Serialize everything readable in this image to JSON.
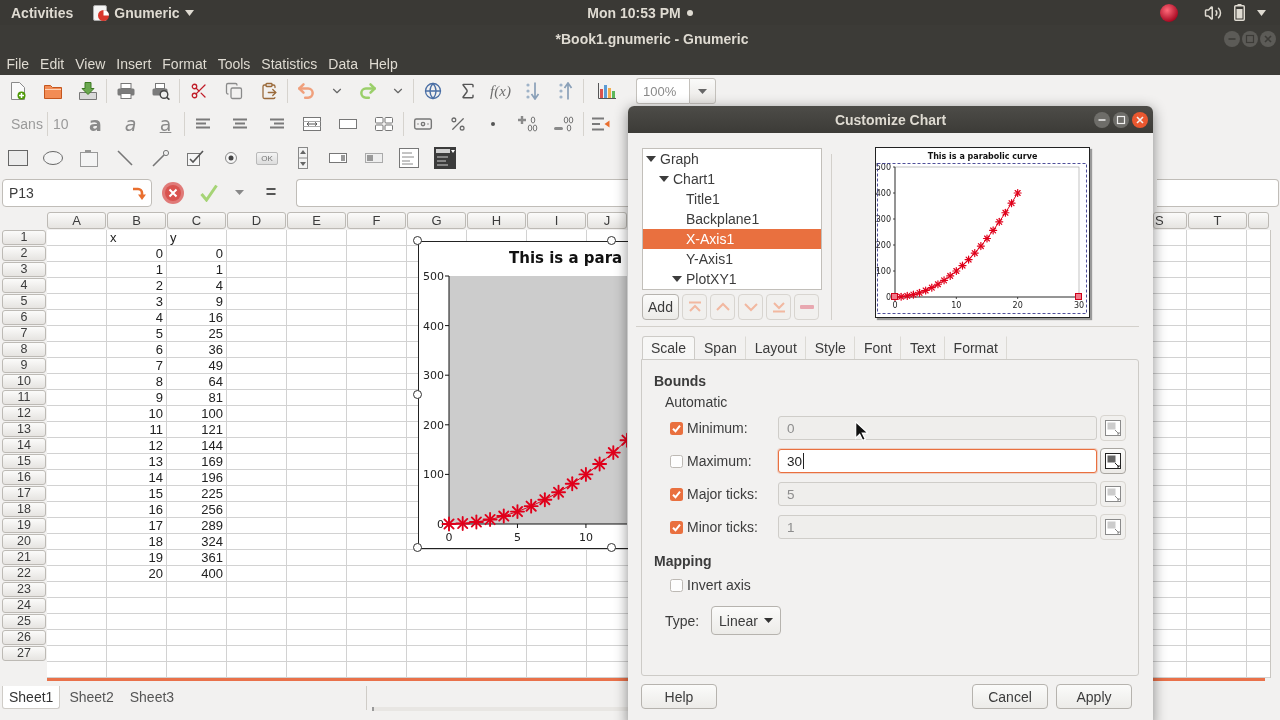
{
  "top_bar": {
    "activities": "Activities",
    "app_name": "Gnumeric",
    "clock": "Mon 10:53 PM"
  },
  "window": {
    "title": "*Book1.gnumeric - Gnumeric"
  },
  "menu": [
    "File",
    "Edit",
    "View",
    "Insert",
    "Format",
    "Tools",
    "Statistics",
    "Data",
    "Help"
  ],
  "toolbar": {
    "function_label": "f(x)",
    "zoom": "100%",
    "font_name": "Sans",
    "font_size": "10",
    "text_styles": [
      {
        "kind": "bold",
        "glyph": "a"
      },
      {
        "kind": "italic",
        "glyph": "a"
      },
      {
        "kind": "underline",
        "glyph": "a"
      }
    ],
    "button_tool_label": "OK"
  },
  "formula_bar": {
    "cell_ref": "P13",
    "equals": "="
  },
  "sheet": {
    "columns": [
      "A",
      "B",
      "C",
      "D",
      "E",
      "F",
      "G",
      "H",
      "I",
      "J"
    ],
    "far_columns": [
      "S",
      "T"
    ],
    "rows": [
      {
        "number": "1",
        "kind": "text",
        "column_b": "x",
        "column_c": "y"
      },
      {
        "number": "2",
        "kind": "number",
        "column_b": "0",
        "column_c": "0"
      },
      {
        "number": "3",
        "kind": "number",
        "column_b": "1",
        "column_c": "1"
      },
      {
        "number": "4",
        "kind": "number",
        "column_b": "2",
        "column_c": "4"
      },
      {
        "number": "5",
        "kind": "number",
        "column_b": "3",
        "column_c": "9"
      },
      {
        "number": "6",
        "kind": "number",
        "column_b": "4",
        "column_c": "16"
      },
      {
        "number": "7",
        "kind": "number",
        "column_b": "5",
        "column_c": "25"
      },
      {
        "number": "8",
        "kind": "number",
        "column_b": "6",
        "column_c": "36"
      },
      {
        "number": "9",
        "kind": "number",
        "column_b": "7",
        "column_c": "49"
      },
      {
        "number": "10",
        "kind": "number",
        "column_b": "8",
        "column_c": "64"
      },
      {
        "number": "11",
        "kind": "number",
        "column_b": "9",
        "column_c": "81"
      },
      {
        "number": "12",
        "kind": "number",
        "column_b": "10",
        "column_c": "100"
      },
      {
        "number": "13",
        "kind": "number",
        "column_b": "11",
        "column_c": "121"
      },
      {
        "number": "14",
        "kind": "number",
        "column_b": "12",
        "column_c": "144"
      },
      {
        "number": "15",
        "kind": "number",
        "column_b": "13",
        "column_c": "169"
      },
      {
        "number": "16",
        "kind": "number",
        "column_b": "14",
        "column_c": "196"
      },
      {
        "number": "17",
        "kind": "number",
        "column_b": "15",
        "column_c": "225"
      },
      {
        "number": "18",
        "kind": "number",
        "column_b": "16",
        "column_c": "256"
      },
      {
        "number": "19",
        "kind": "number",
        "column_b": "17",
        "column_c": "289"
      },
      {
        "number": "20",
        "kind": "number",
        "column_b": "18",
        "column_c": "324"
      },
      {
        "number": "21",
        "kind": "number",
        "column_b": "19",
        "column_c": "361"
      },
      {
        "number": "22",
        "kind": "number",
        "column_b": "20",
        "column_c": "400"
      },
      {
        "number": "23",
        "kind": "empty"
      },
      {
        "number": "24",
        "kind": "empty"
      },
      {
        "number": "25",
        "kind": "empty"
      },
      {
        "number": "26",
        "kind": "empty"
      },
      {
        "number": "27",
        "kind": "empty"
      }
    ]
  },
  "sheet_chart": {
    "chart_data": [
      {
        "type": "line",
        "title": "This is a para",
        "x": [
          0,
          1,
          2,
          3,
          4,
          5,
          6,
          7,
          8,
          9,
          10,
          11,
          12,
          13
        ],
        "values": [
          0,
          1,
          4,
          9,
          16,
          25,
          36,
          49,
          64,
          81,
          100,
          121,
          144,
          169
        ],
        "color": "#e0001b",
        "marker": "cross",
        "xlim": [
          0,
          13
        ],
        "ylim": [
          0,
          500
        ],
        "yticks": [
          0,
          100,
          200,
          300,
          400,
          500
        ],
        "xticks": [
          0,
          5,
          10
        ]
      }
    ]
  },
  "sheet_tabs": [
    {
      "label": "Sheet1",
      "selected": true
    },
    {
      "label": "Sheet2",
      "selected": false
    },
    {
      "label": "Sheet3",
      "selected": false
    }
  ],
  "dialog": {
    "title": "Customize Chart",
    "tree": [
      {
        "label": "Graph",
        "expanded": true,
        "selected": false,
        "children": [
          {
            "label": "Chart1",
            "expanded": true,
            "selected": false,
            "children": [
              {
                "label": "Title1",
                "selected": false
              },
              {
                "label": "Backplane1",
                "selected": false
              },
              {
                "label": "X-Axis1",
                "selected": true
              },
              {
                "label": "Y-Axis1",
                "selected": false
              },
              {
                "label": "PlotXY1",
                "expanded": true,
                "selected": false
              }
            ]
          }
        ]
      }
    ],
    "add_button": "Add",
    "tree_tools": [
      {
        "kind": "top",
        "disabled": true
      },
      {
        "kind": "up",
        "disabled": true
      },
      {
        "kind": "down",
        "disabled": true
      },
      {
        "kind": "bottom",
        "disabled": true
      },
      {
        "kind": "remove",
        "disabled": true
      }
    ],
    "preview": {
      "chart_data": [
        {
          "type": "line",
          "title": "This is a parabolic curve",
          "x": [
            0,
            1,
            2,
            3,
            4,
            5,
            6,
            7,
            8,
            9,
            10,
            11,
            12,
            13,
            14,
            15,
            16,
            17,
            18,
            19,
            20
          ],
          "values": [
            0,
            1,
            4,
            9,
            16,
            25,
            36,
            49,
            64,
            81,
            100,
            121,
            144,
            169,
            196,
            225,
            256,
            289,
            324,
            361,
            400
          ],
          "color": "#e0001b",
          "marker": "cross",
          "xlim": [
            0,
            30
          ],
          "ylim": [
            0,
            500
          ],
          "xticks": [
            0,
            10,
            20,
            30
          ],
          "yticks": [
            0,
            100,
            200,
            300,
            400,
            500
          ]
        }
      ]
    },
    "tabs": [
      {
        "label": "Scale",
        "selected": true
      },
      {
        "label": "Span",
        "selected": false
      },
      {
        "label": "Layout",
        "selected": false
      },
      {
        "label": "Style",
        "selected": false
      },
      {
        "label": "Font",
        "selected": false
      },
      {
        "label": "Text",
        "selected": false
      },
      {
        "label": "Format",
        "selected": false
      }
    ],
    "scale": {
      "bounds_heading": "Bounds",
      "automatic_label": "Automatic",
      "bounds": [
        {
          "label": "Minimum:",
          "checked": true,
          "value": "0",
          "focused": false
        },
        {
          "label": "Maximum:",
          "checked": false,
          "value": "30",
          "focused": true
        },
        {
          "label": "Major ticks:",
          "checked": true,
          "value": "5",
          "focused": false
        },
        {
          "label": "Minor ticks:",
          "checked": true,
          "value": "1",
          "focused": false
        }
      ],
      "mapping_heading": "Mapping",
      "invert_axis": {
        "label": "Invert axis",
        "checked": false
      },
      "type_label": "Type:",
      "type_value": "Linear"
    },
    "help_button": "Help",
    "action_buttons": [
      "Cancel",
      "Apply"
    ]
  }
}
